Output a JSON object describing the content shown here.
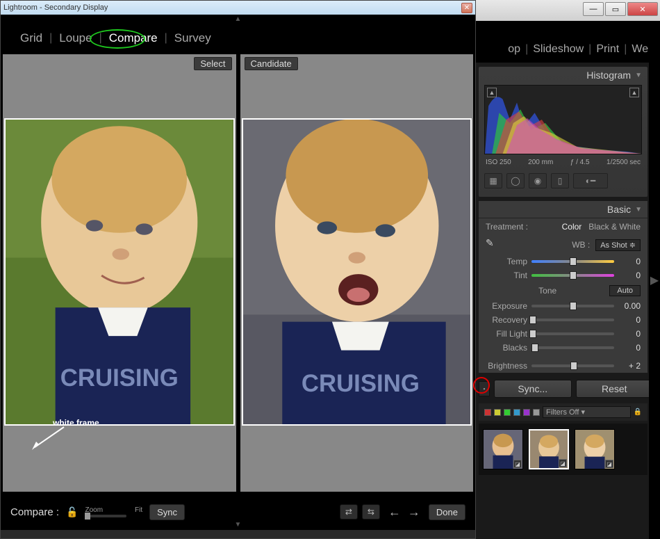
{
  "secondary": {
    "title": "Lightroom - Secondary Display",
    "tabs": [
      "Grid",
      "Loupe",
      "Compare",
      "Survey"
    ],
    "active_tab": "Compare",
    "select_label": "Select",
    "candidate_label": "Candidate",
    "annotation_label": "white frame",
    "bottom": {
      "label": "Compare :",
      "zoom_label": "Zoom",
      "fit_label": "Fit",
      "sync_label": "Sync",
      "done_label": "Done"
    }
  },
  "main": {
    "modules": [
      "op",
      "Slideshow",
      "Print",
      "Web"
    ],
    "histogram": {
      "title": "Histogram",
      "iso": "ISO 250",
      "focal": "200 mm",
      "aperture": "ƒ / 4.5",
      "shutter": "1/2500 sec"
    },
    "basic": {
      "title": "Basic",
      "treatment_label": "Treatment :",
      "treatment_options": [
        "Color",
        "Black & White"
      ],
      "treatment_active": "Color",
      "wb_label": "WB :",
      "wb_value": "As Shot",
      "sliders": {
        "temp": {
          "label": "Temp",
          "value": "0",
          "pos": 50
        },
        "tint": {
          "label": "Tint",
          "value": "0",
          "pos": 50
        },
        "tone_label": "Tone",
        "auto_label": "Auto",
        "exposure": {
          "label": "Exposure",
          "value": "0.00",
          "pos": 50
        },
        "recovery": {
          "label": "Recovery",
          "value": "0",
          "pos": 0
        },
        "fill": {
          "label": "Fill Light",
          "value": "0",
          "pos": 0
        },
        "blacks": {
          "label": "Blacks",
          "value": "0",
          "pos": 3
        },
        "brightness": {
          "label": "Brightness",
          "value": "+ 2",
          "pos": 51
        }
      }
    },
    "sync_label": "Sync...",
    "reset_label": "Reset",
    "filter": {
      "colors": [
        "#c33",
        "#c93",
        "#cc3",
        "#3c3",
        "#39c",
        "#93c"
      ],
      "label": "Filters Off"
    }
  }
}
